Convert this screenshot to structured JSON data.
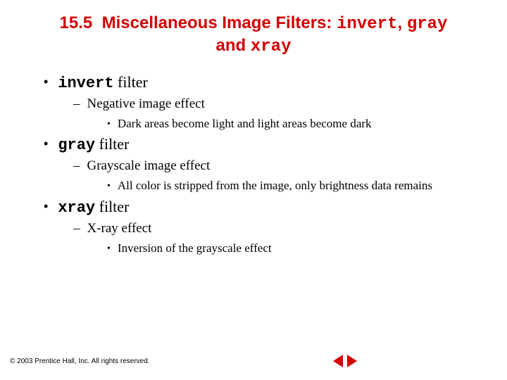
{
  "title": {
    "section_number": "15.5",
    "plain_1": "Miscellaneous Image Filters:",
    "code_1": "invert",
    "comma": ",",
    "code_2": "gray",
    "conj": "and",
    "code_3": "xray"
  },
  "items": [
    {
      "code": "invert",
      "word": "filter",
      "sub": {
        "text": "Negative image effect",
        "detail": "Dark areas become light and light areas become dark"
      }
    },
    {
      "code": "gray",
      "word": "filter",
      "sub": {
        "text": "Grayscale image effect",
        "detail": "All color is stripped from the image, only brightness data remains"
      }
    },
    {
      "code": "xray",
      "word": "filter",
      "sub": {
        "text": "X-ray effect",
        "detail": "Inversion of the grayscale effect"
      }
    }
  ],
  "footer": {
    "copyright": "© 2003 Prentice Hall, Inc.  All rights reserved."
  },
  "colors": {
    "accent": "#d40000"
  }
}
